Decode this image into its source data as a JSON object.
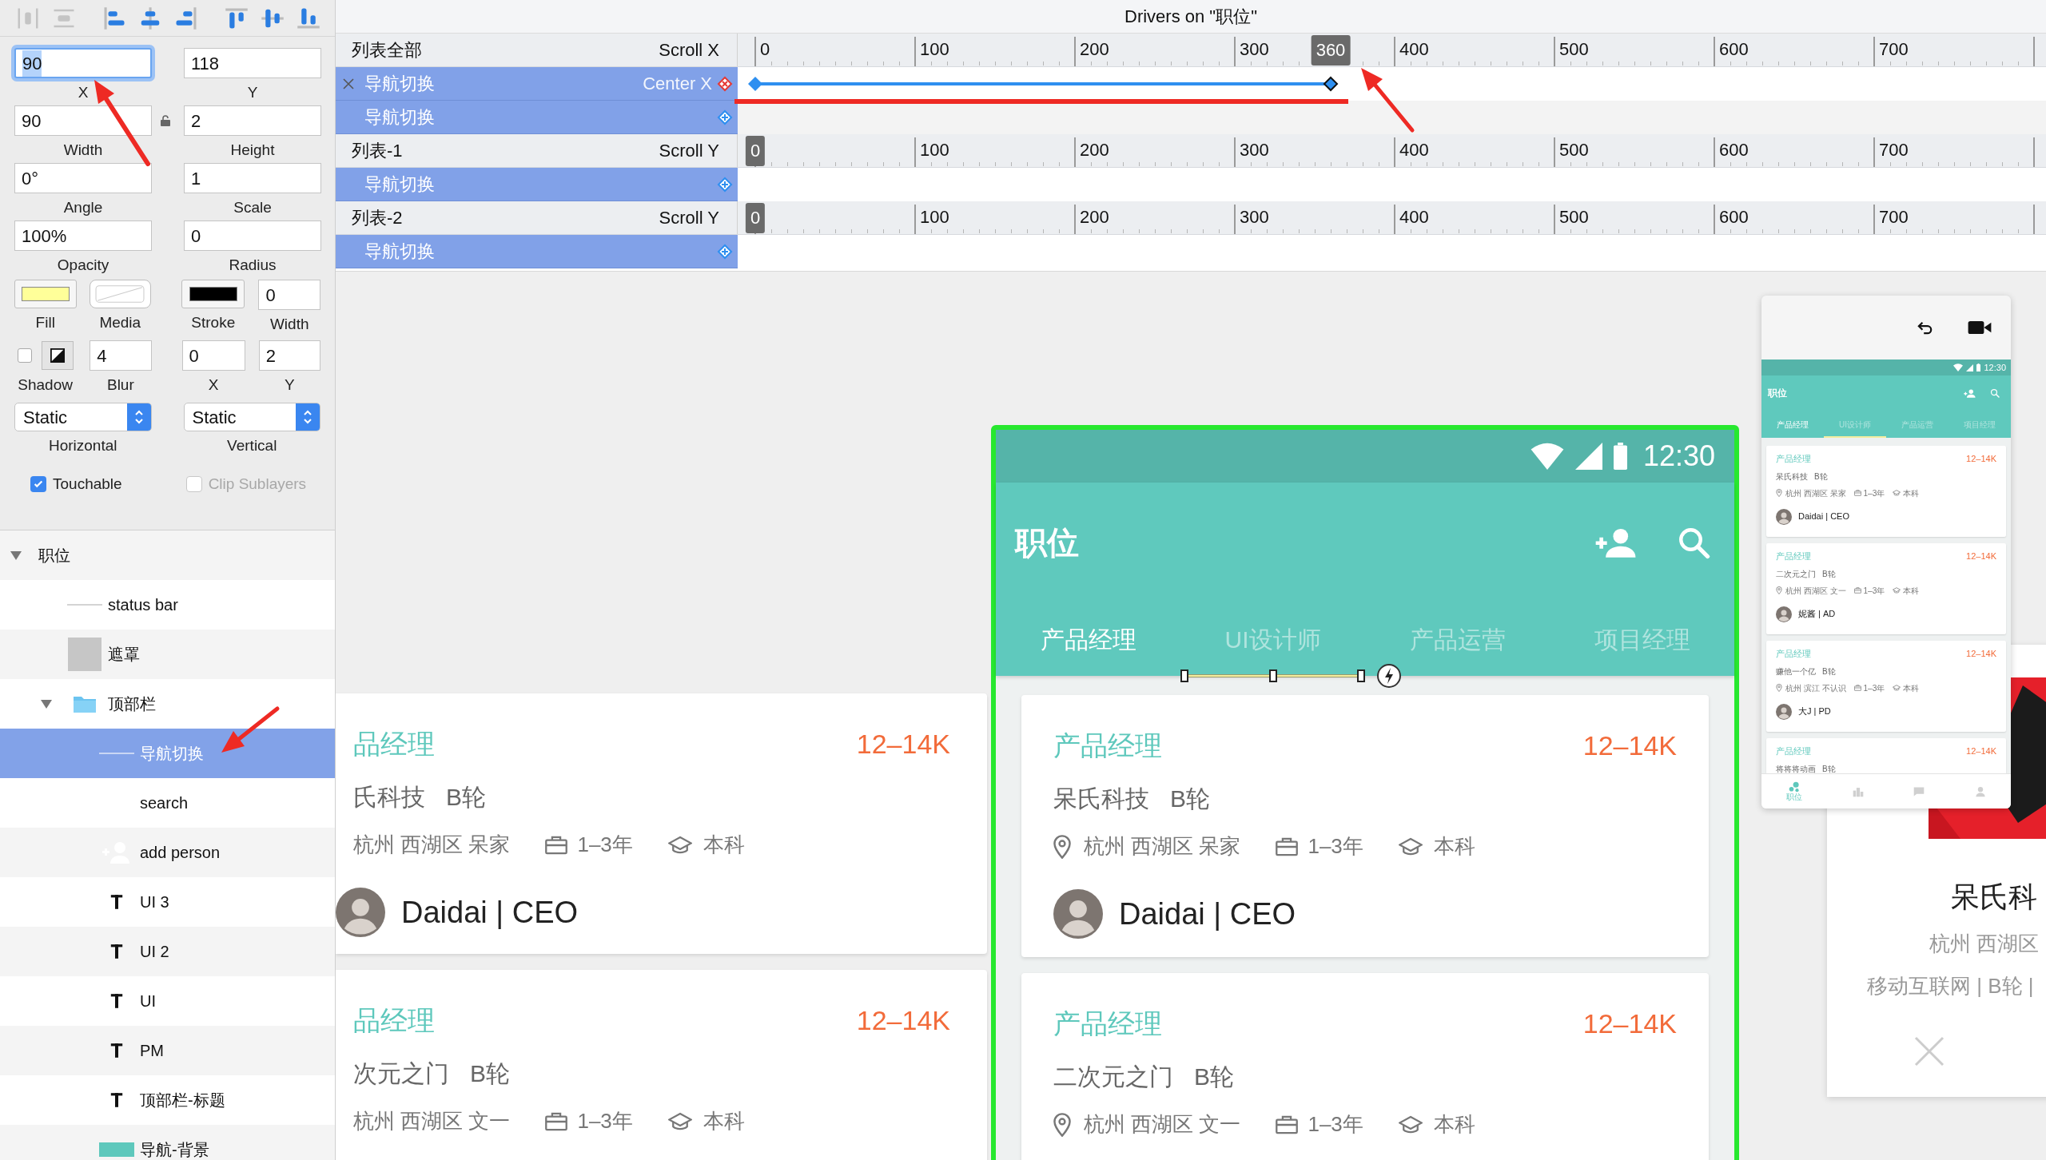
{
  "toolbar": [
    {
      "kind": "distribute-horizontal",
      "disabled": true
    },
    {
      "kind": "distribute-vertical",
      "disabled": true
    },
    {
      "kind": "align-left",
      "disabled": false
    },
    {
      "kind": "align-center",
      "disabled": false
    },
    {
      "kind": "align-right",
      "disabled": false
    },
    {
      "kind": "align-top",
      "disabled": false
    },
    {
      "kind": "align-middle",
      "disabled": false
    },
    {
      "kind": "align-bottom",
      "disabled": false
    }
  ],
  "inspector": {
    "geometry": [
      {
        "label": "X",
        "value": "90",
        "focused": true
      },
      {
        "label": "Y",
        "value": "118",
        "focused": false
      },
      {
        "label": "Width",
        "value": "90",
        "focused": false
      },
      {
        "label": "Height",
        "value": "2",
        "focused": false
      },
      {
        "label": "Angle",
        "value": "0°",
        "focused": false
      },
      {
        "label": "Scale",
        "value": "1",
        "focused": false
      },
      {
        "label": "Opacity",
        "value": "100%",
        "focused": false
      },
      {
        "label": "Radius",
        "value": "0",
        "focused": false
      }
    ],
    "fill": {
      "label": "Fill",
      "color": "#ffff99"
    },
    "media": {
      "label": "Media"
    },
    "stroke": {
      "label": "Stroke",
      "color": "#000000"
    },
    "stroke_width": {
      "label": "Width",
      "value": "0"
    },
    "shadow": {
      "label": "Shadow",
      "checked": false
    },
    "shadow_fields": [
      {
        "label": "Blur",
        "value": "4"
      },
      {
        "label": "X",
        "value": "0"
      },
      {
        "label": "Y",
        "value": "2"
      }
    ],
    "constraints": [
      {
        "label": "Horizontal",
        "value": "Static"
      },
      {
        "label": "Vertical",
        "value": "Static"
      }
    ],
    "toggles": [
      {
        "label": "Touchable",
        "checked": true,
        "disabled": false
      },
      {
        "label": "Clip Sublayers",
        "checked": false,
        "disabled": true
      }
    ]
  },
  "layers": [
    {
      "name": "职位",
      "expanded": true,
      "selected": false,
      "children": [
        {
          "name": "status bar",
          "kind": "line",
          "selected": false
        },
        {
          "name": "遮罩",
          "kind": "thumbnail",
          "selected": false
        },
        {
          "name": "顶部栏",
          "kind": "folder",
          "expanded": true,
          "selected": false,
          "children": [
            {
              "name": "导航切换",
              "kind": "line",
              "selected": true
            },
            {
              "name": "search",
              "kind": "plain",
              "selected": false
            },
            {
              "name": "add person",
              "kind": "person",
              "selected": false
            },
            {
              "name": "UI 3",
              "kind": "text",
              "selected": false
            },
            {
              "name": "UI 2",
              "kind": "text",
              "selected": false
            },
            {
              "name": "UI",
              "kind": "text",
              "selected": false
            },
            {
              "name": "PM",
              "kind": "text",
              "selected": false
            },
            {
              "name": "顶部栏-标题",
              "kind": "text",
              "selected": false
            },
            {
              "name": "导航-背景",
              "kind": "swatch",
              "selected": false
            }
          ]
        }
      ]
    }
  ],
  "timeline": {
    "title": "Drivers on \"职位\"",
    "tracks": [
      {
        "layer": "列表全部",
        "property": "Scroll X",
        "ruler_labels": [
          "0",
          "100",
          "200",
          "300",
          "400",
          "500",
          "600",
          "700"
        ],
        "marker": "360",
        "level": 0.45,
        "drivers": [
          {
            "name": "导航切换",
            "property": "Center X",
            "active": true
          },
          {
            "name": "导航切换",
            "active": false
          }
        ]
      },
      {
        "layer": "列表-1",
        "property": "Scroll Y",
        "ruler_labels": [
          "100",
          "200",
          "300",
          "400",
          "500",
          "600",
          "700"
        ],
        "marker": "0",
        "level": 0,
        "drivers": [
          {
            "name": "导航切换",
            "active": false
          }
        ]
      },
      {
        "layer": "列表-2",
        "property": "Scroll Y",
        "ruler_labels": [
          "100",
          "200",
          "300",
          "400",
          "500",
          "600",
          "700"
        ],
        "marker": "0",
        "level": 0,
        "drivers": [
          {
            "name": "导航切换",
            "active": false
          }
        ]
      }
    ]
  },
  "canvas": {
    "left_cards": [
      {
        "title": "品经理",
        "salary": "12–14K",
        "company": "氏科技",
        "round": "B轮",
        "location": "杭州 西湖区 呆家",
        "experience": "1–3年",
        "education": "本科",
        "person": "Daidai | CEO"
      },
      {
        "title": "品经理",
        "salary": "12–14K",
        "company": "次元之门",
        "round": "B轮",
        "location": "杭州 西湖区 文一",
        "experience": "1–3年",
        "education": "本科"
      }
    ],
    "phone": {
      "time": "12:30",
      "title": "职位",
      "tabs": [
        {
          "label": "产品经理",
          "selected": true,
          "indicator": false
        },
        {
          "label": "UI设计师",
          "selected": false,
          "indicator": true
        },
        {
          "label": "产品运营",
          "selected": false,
          "indicator": false
        },
        {
          "label": "项目经理",
          "selected": false,
          "indicator": false
        }
      ],
      "cards": [
        {
          "title": "产品经理",
          "salary": "12–14K",
          "company": "呆氏科技",
          "round": "B轮",
          "location": "杭州 西湖区 呆家",
          "experience": "1–3年",
          "education": "本科",
          "person": "Daidai | CEO"
        },
        {
          "title": "产品经理",
          "salary": "12–14K",
          "company": "二次元之门",
          "round": "B轮",
          "location": "杭州 西湖区 文一",
          "experience": "1–3年",
          "education": "本科"
        }
      ]
    },
    "preview": {
      "time": "12:30",
      "title": "职位",
      "tabs": [
        {
          "label": "产品经理",
          "selected": true,
          "indicator": false
        },
        {
          "label": "UI设计师",
          "selected": false,
          "indicator": true
        },
        {
          "label": "产品运营",
          "selected": false,
          "indicator": false
        },
        {
          "label": "项目经理",
          "selected": false,
          "indicator": false
        }
      ],
      "cards": [
        {
          "title": "产品经理",
          "salary": "12–14K",
          "company": "呆氏科技",
          "round": "B轮",
          "location": "杭州 西湖区 呆家",
          "experience": "1–3年",
          "education": "本科",
          "person": "Daidai | CEO"
        },
        {
          "title": "产品经理",
          "salary": "12–14K",
          "company": "二次元之门",
          "round": "B轮",
          "location": "杭州 西湖区 文一",
          "experience": "1–3年",
          "education": "本科",
          "person": "妮酱 | AD"
        },
        {
          "title": "产品经理",
          "salary": "12–14K",
          "company": "赚他一个亿",
          "round": "B轮",
          "location": "杭州 滨江 不认识",
          "experience": "1–3年",
          "education": "本科",
          "person": "大J | PD"
        },
        {
          "title": "产品经理",
          "salary": "12–14K",
          "company": "将将将动画",
          "round": "B轮"
        }
      ],
      "nav": [
        {
          "kind": "dots",
          "label": "职位",
          "selected": true
        },
        {
          "kind": "buildings",
          "selected": false
        },
        {
          "kind": "chat",
          "selected": false
        },
        {
          "kind": "person",
          "selected": false
        }
      ]
    },
    "detail_card": {
      "company": "呆氏科",
      "location": "杭州 西湖区",
      "tags": "移动互联网 | B轮 |"
    }
  }
}
